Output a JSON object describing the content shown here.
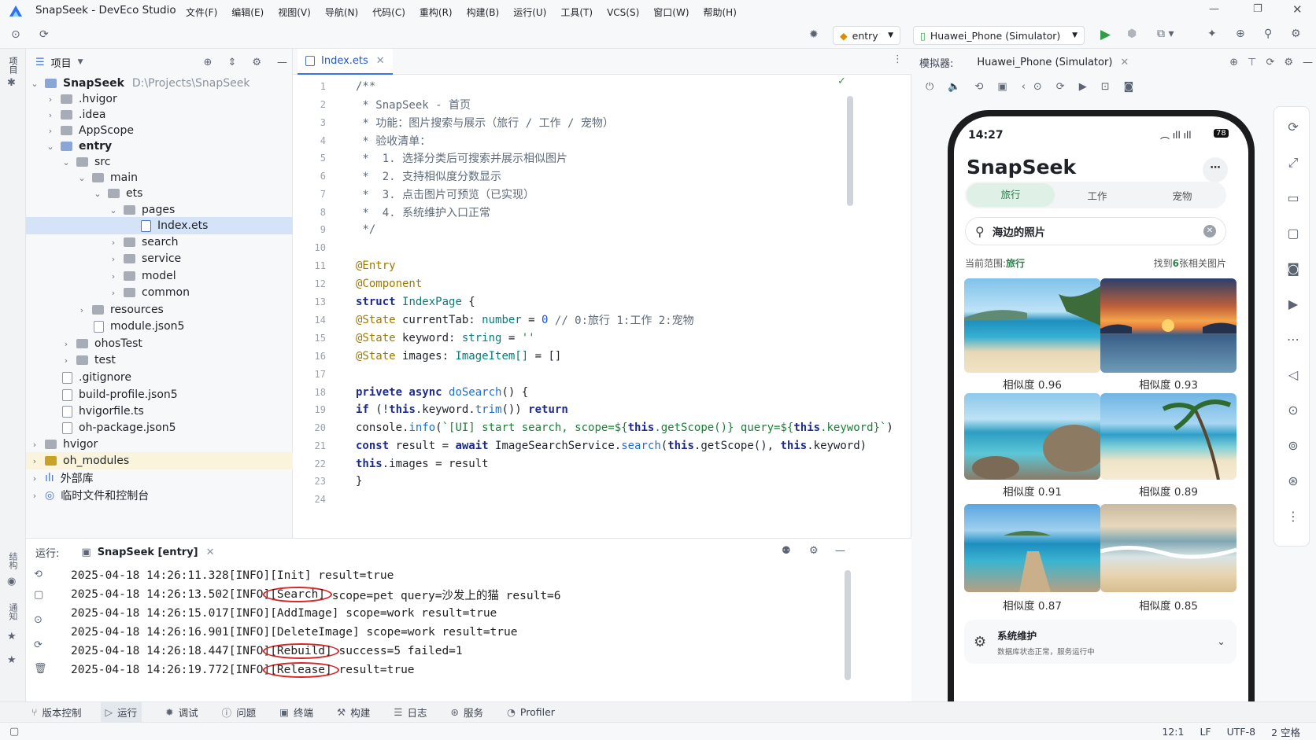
{
  "app": {
    "name": "SnapSeek",
    "ide": "DevEco Studio"
  },
  "menu": [
    "文件(F)",
    "编辑(E)",
    "视图(V)",
    "导航(N)",
    "代码(C)",
    "重构(R)",
    "构建(B)",
    "运行(U)",
    "工具(T)",
    "VCS(S)",
    "窗口(W)",
    "帮助(H)"
  ],
  "toolbar": {
    "module": "entry",
    "device": "Huawei_Phone (Simulator)"
  },
  "project": {
    "header": "项目",
    "root_name": "SnapSeek",
    "root_path": "D:\\Projects\\SnapSeek",
    "items": [
      ".hvigor",
      ".idea",
      "AppScope",
      "entry",
      "src",
      "main",
      "ets",
      "pages",
      "Index.ets",
      "search",
      "service",
      "model",
      "common",
      "resources",
      "module.json5",
      "ohosTest",
      "test",
      ".gitignore",
      "build-profile.json5",
      "hvigorfile.ts",
      "oh-package.json5",
      "hvigor",
      "oh_modules",
      "外部库",
      "临时文件和控制台"
    ]
  },
  "editor": {
    "tab": "Index.ets",
    "lines": [
      "1",
      "2",
      "3",
      "4",
      "5",
      "6",
      "7",
      "8",
      "9",
      "10",
      "11",
      "12",
      "13",
      "14",
      "15",
      "16",
      "17",
      "18",
      "19",
      "20",
      "21",
      "22",
      "23",
      "24"
    ],
    "code": {
      "l1": "/**",
      "l2": " * SnapSeek - 首页",
      "l3": " * 功能：图片搜索与展示（旅行 / 工作 / 宠物）",
      "l4": " * 验收清单：",
      "l5": " *  1. 选择分类后可搜索并展示相似图片",
      "l6": " *  2. 支持相似度分数显示",
      "l7": " *  3. 点击图片可预览（已实现）",
      "l8": " *  4. 系统维护入口正常",
      "l9": " */",
      "l11": "@Entry",
      "l12": "@Component",
      "l13a": "struct ",
      "l13b": "IndexPage",
      " l13c": " {",
      "l14a": "@State",
      " l14b": " currentTab: ",
      "l14c": "number",
      "l14d": " = ",
      "l14e": "0",
      "l14f": " // 0:旅行 1:工作 2:宠物",
      "l15a": "@State",
      " l15b": " keyword: ",
      "l15c": "string",
      "l15d": " = ",
      "l15e": "''",
      "l16a": "@State",
      " l16b": " images: ",
      "l16c": "ImageItem[]",
      "l16d": " = []",
      "l18a": "privete async ",
      "l18b": "doSearch",
      "l18c": "() {",
      "l19a": "if",
      " l19b": " (!",
      "l19c": "this",
      ".keyword.": ".keyword.",
      "l19d": "trim",
      "l19e": "()) ",
      "l19f": "return",
      "l20a": "console.",
      "l20b": "info",
      "l20c": "(",
      "l20d": "`[UI] start search, scope=${",
      "l20e": "this",
      "l20f": ".getScope()} query=${",
      "l20g": "this",
      "l20h": ".keyword}`",
      ")": ")",
      "l21a": "const",
      " l21b": " result = ",
      "l21c": "await",
      " l21d": " ImageSearchService.",
      "l21e": "search",
      "l21f": "(",
      "l21g": "this",
      "l21h": ".getScope(), ",
      "l21i": "this",
      "l21j": ".keyword)",
      "l22a": "this",
      "l22b": ".images = result",
      "l23": "}"
    }
  },
  "run": {
    "label": "运行:",
    "tab": "SnapSeek [entry]",
    "logs": [
      {
        "time": "2025-04-18 14:26:11.328",
        "level": "[INFO]",
        "tag": "[Init]",
        "msg": " result=true"
      },
      {
        "time": "2025-04-18 14:26:13.502",
        "level": "[INFO]",
        "tag": "[Search]",
        "msg": " scope=pet query=沙发上的猫 result=6"
      },
      {
        "time": "2025-04-18 14:26:15.017",
        "level": "[INFO]",
        "tag": "[AddImage]",
        "msg": " scope=work result=true"
      },
      {
        "time": "2025-04-18 14:26:16.901",
        "level": "[INFO]",
        "tag": "[DeleteImage]",
        "msg": " scope=work result=true"
      },
      {
        "time": "2025-04-18 14:26:18.447",
        "level": "[INFO]",
        "tag": "[Rebuild]",
        "msg": " success=5 failed=1"
      },
      {
        "time": "2025-04-18 14:26:19.772",
        "level": "[INFO]",
        "tag": "[Release]",
        "msg": " result=true"
      }
    ]
  },
  "bottom_tabs": [
    "版本控制",
    "运行",
    "调试",
    "问题",
    "终端",
    "构建",
    "日志",
    "服务",
    "Profiler"
  ],
  "status": {
    "pos": "12:1",
    "eol": "LF",
    "enc": "UTF-8",
    "indent": "2 空格"
  },
  "simulator": {
    "label": "模拟器:",
    "device": "Huawei_Phone (Simulator)"
  },
  "phone": {
    "time": "14:27",
    "battery": "78",
    "app_title": "SnapSeek",
    "tabs": [
      "旅行",
      "工作",
      "宠物"
    ],
    "search_value": "海边的照片",
    "scope_label": "当前范围: ",
    "scope_value": "旅行",
    "found_prefix": "找到 ",
    "found_count": "6",
    "found_suffix": " 张相关图片",
    "sim_label": "相似度",
    "scores": [
      "0.96",
      "0.93",
      "0.91",
      "0.89",
      "0.87",
      "0.85"
    ],
    "maint_title": "系统维护",
    "maint_sub": "数据库状态正常，服务运行中"
  },
  "colors": {
    "accent": "#2f7d4f",
    "tab_active_bg": "#dff0e6",
    "circle": "#d62828"
  }
}
